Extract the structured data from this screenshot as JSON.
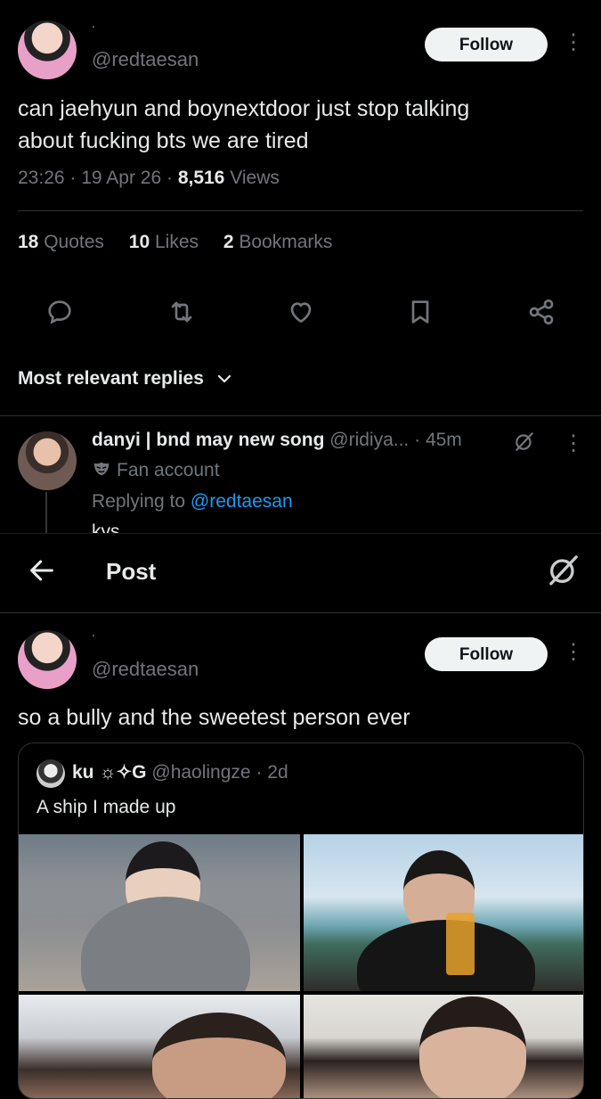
{
  "first_post": {
    "display_name": "'",
    "handle": "@redtaesan",
    "follow_label": "Follow",
    "text_line1": "can jaehyun and boynextdoor just stop talking",
    "text_line2": "about fucking bts we are tired",
    "time": "23:26",
    "date": "19 Apr 26",
    "views_count": "8,516",
    "views_label": "Views",
    "stats": [
      {
        "count": "18",
        "label": "Quotes"
      },
      {
        "count": "10",
        "label": "Likes"
      },
      {
        "count": "2",
        "label": "Bookmarks"
      }
    ],
    "actions": [
      "reply-icon",
      "repost-icon",
      "like-icon",
      "bookmark-icon",
      "share-icon"
    ],
    "replies_sort": "Most relevant replies"
  },
  "reply": {
    "name": "danyi | bnd may new song",
    "handle": "@ridiya...",
    "time": "· 45m",
    "badge_label": "Fan account",
    "replying_prefix": "Replying to",
    "replying_handle": "@redtaesan",
    "text_cut": "kys"
  },
  "nav": {
    "title": "Post"
  },
  "second_post": {
    "display_name": "'",
    "handle": "@redtaesan",
    "follow_label": "Follow",
    "text": "so a bully and the sweetest person ever",
    "quote": {
      "name": "ku ☼✧G",
      "handle": "@haolingze",
      "time": "· 2d",
      "text": "A ship I made up"
    }
  },
  "colors": {
    "background": "#000000",
    "text": "#e7e9ea",
    "muted": "#71767b",
    "link": "#1d9bf0",
    "divider": "#2f3336",
    "follow_bg": "#eff3f4"
  }
}
